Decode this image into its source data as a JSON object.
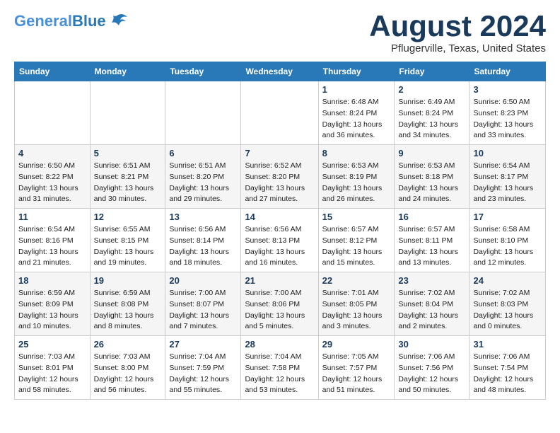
{
  "logo": {
    "line1": "General",
    "line2": "Blue"
  },
  "title": "August 2024",
  "location": "Pflugerville, Texas, United States",
  "days_of_week": [
    "Sunday",
    "Monday",
    "Tuesday",
    "Wednesday",
    "Thursday",
    "Friday",
    "Saturday"
  ],
  "weeks": [
    [
      {
        "day": "",
        "info": ""
      },
      {
        "day": "",
        "info": ""
      },
      {
        "day": "",
        "info": ""
      },
      {
        "day": "",
        "info": ""
      },
      {
        "day": "1",
        "info": "Sunrise: 6:48 AM\nSunset: 8:24 PM\nDaylight: 13 hours\nand 36 minutes."
      },
      {
        "day": "2",
        "info": "Sunrise: 6:49 AM\nSunset: 8:24 PM\nDaylight: 13 hours\nand 34 minutes."
      },
      {
        "day": "3",
        "info": "Sunrise: 6:50 AM\nSunset: 8:23 PM\nDaylight: 13 hours\nand 33 minutes."
      }
    ],
    [
      {
        "day": "4",
        "info": "Sunrise: 6:50 AM\nSunset: 8:22 PM\nDaylight: 13 hours\nand 31 minutes."
      },
      {
        "day": "5",
        "info": "Sunrise: 6:51 AM\nSunset: 8:21 PM\nDaylight: 13 hours\nand 30 minutes."
      },
      {
        "day": "6",
        "info": "Sunrise: 6:51 AM\nSunset: 8:20 PM\nDaylight: 13 hours\nand 29 minutes."
      },
      {
        "day": "7",
        "info": "Sunrise: 6:52 AM\nSunset: 8:20 PM\nDaylight: 13 hours\nand 27 minutes."
      },
      {
        "day": "8",
        "info": "Sunrise: 6:53 AM\nSunset: 8:19 PM\nDaylight: 13 hours\nand 26 minutes."
      },
      {
        "day": "9",
        "info": "Sunrise: 6:53 AM\nSunset: 8:18 PM\nDaylight: 13 hours\nand 24 minutes."
      },
      {
        "day": "10",
        "info": "Sunrise: 6:54 AM\nSunset: 8:17 PM\nDaylight: 13 hours\nand 23 minutes."
      }
    ],
    [
      {
        "day": "11",
        "info": "Sunrise: 6:54 AM\nSunset: 8:16 PM\nDaylight: 13 hours\nand 21 minutes."
      },
      {
        "day": "12",
        "info": "Sunrise: 6:55 AM\nSunset: 8:15 PM\nDaylight: 13 hours\nand 19 minutes."
      },
      {
        "day": "13",
        "info": "Sunrise: 6:56 AM\nSunset: 8:14 PM\nDaylight: 13 hours\nand 18 minutes."
      },
      {
        "day": "14",
        "info": "Sunrise: 6:56 AM\nSunset: 8:13 PM\nDaylight: 13 hours\nand 16 minutes."
      },
      {
        "day": "15",
        "info": "Sunrise: 6:57 AM\nSunset: 8:12 PM\nDaylight: 13 hours\nand 15 minutes."
      },
      {
        "day": "16",
        "info": "Sunrise: 6:57 AM\nSunset: 8:11 PM\nDaylight: 13 hours\nand 13 minutes."
      },
      {
        "day": "17",
        "info": "Sunrise: 6:58 AM\nSunset: 8:10 PM\nDaylight: 13 hours\nand 12 minutes."
      }
    ],
    [
      {
        "day": "18",
        "info": "Sunrise: 6:59 AM\nSunset: 8:09 PM\nDaylight: 13 hours\nand 10 minutes."
      },
      {
        "day": "19",
        "info": "Sunrise: 6:59 AM\nSunset: 8:08 PM\nDaylight: 13 hours\nand 8 minutes."
      },
      {
        "day": "20",
        "info": "Sunrise: 7:00 AM\nSunset: 8:07 PM\nDaylight: 13 hours\nand 7 minutes."
      },
      {
        "day": "21",
        "info": "Sunrise: 7:00 AM\nSunset: 8:06 PM\nDaylight: 13 hours\nand 5 minutes."
      },
      {
        "day": "22",
        "info": "Sunrise: 7:01 AM\nSunset: 8:05 PM\nDaylight: 13 hours\nand 3 minutes."
      },
      {
        "day": "23",
        "info": "Sunrise: 7:02 AM\nSunset: 8:04 PM\nDaylight: 13 hours\nand 2 minutes."
      },
      {
        "day": "24",
        "info": "Sunrise: 7:02 AM\nSunset: 8:03 PM\nDaylight: 13 hours\nand 0 minutes."
      }
    ],
    [
      {
        "day": "25",
        "info": "Sunrise: 7:03 AM\nSunset: 8:01 PM\nDaylight: 12 hours\nand 58 minutes."
      },
      {
        "day": "26",
        "info": "Sunrise: 7:03 AM\nSunset: 8:00 PM\nDaylight: 12 hours\nand 56 minutes."
      },
      {
        "day": "27",
        "info": "Sunrise: 7:04 AM\nSunset: 7:59 PM\nDaylight: 12 hours\nand 55 minutes."
      },
      {
        "day": "28",
        "info": "Sunrise: 7:04 AM\nSunset: 7:58 PM\nDaylight: 12 hours\nand 53 minutes."
      },
      {
        "day": "29",
        "info": "Sunrise: 7:05 AM\nSunset: 7:57 PM\nDaylight: 12 hours\nand 51 minutes."
      },
      {
        "day": "30",
        "info": "Sunrise: 7:06 AM\nSunset: 7:56 PM\nDaylight: 12 hours\nand 50 minutes."
      },
      {
        "day": "31",
        "info": "Sunrise: 7:06 AM\nSunset: 7:54 PM\nDaylight: 12 hours\nand 48 minutes."
      }
    ]
  ]
}
